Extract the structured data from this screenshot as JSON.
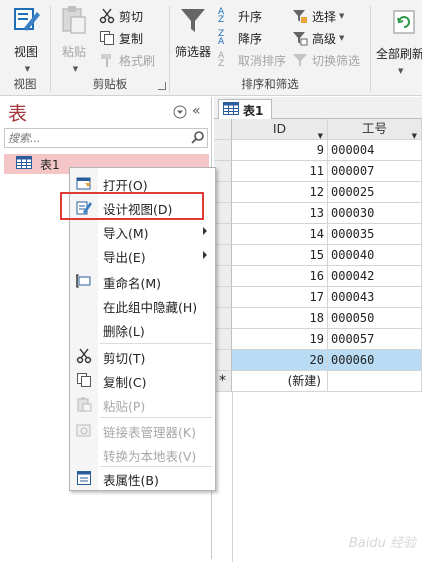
{
  "ribbon": {
    "groups": {
      "view": {
        "label": "视图",
        "view_button": "视图"
      },
      "clipboard": {
        "label": "剪贴板",
        "paste": "粘贴",
        "cut": "剪切",
        "copy": "复制",
        "format_painter": "格式刷"
      },
      "sort_filter": {
        "label": "排序和筛选",
        "filter": "筛选器",
        "asc": "升序",
        "desc": "降序",
        "clear_sort": "取消排序",
        "selection": "选择",
        "advanced": "高级",
        "toggle_filter": "切换筛选"
      },
      "records": {
        "refresh_all": "全部刷新"
      }
    }
  },
  "nav": {
    "title": "表",
    "search_placeholder": "搜索...",
    "items": [
      {
        "label": "表1"
      }
    ]
  },
  "doc": {
    "tab_label": "表1",
    "columns": [
      "ID",
      "工号"
    ],
    "rows": [
      {
        "id": "9",
        "code": "000004"
      },
      {
        "id": "11",
        "code": "000007"
      },
      {
        "id": "12",
        "code": "000025"
      },
      {
        "id": "13",
        "code": "000030"
      },
      {
        "id": "14",
        "code": "000035"
      },
      {
        "id": "15",
        "code": "000040"
      },
      {
        "id": "16",
        "code": "000042"
      },
      {
        "id": "17",
        "code": "000043"
      },
      {
        "id": "18",
        "code": "000050"
      },
      {
        "id": "19",
        "code": "000057"
      },
      {
        "id": "20",
        "code": "000060"
      }
    ],
    "new_row_marker": "*",
    "new_row_label": "(新建)"
  },
  "context_menu": {
    "items": [
      {
        "label": "打开(O)",
        "icon": "open-icon"
      },
      {
        "label": "设计视图(D)",
        "icon": "design-view-icon"
      },
      {
        "label": "导入(M)",
        "icon": ""
      },
      {
        "label": "导出(E)",
        "icon": ""
      },
      {
        "label": "重命名(M)",
        "icon": "rename-icon"
      },
      {
        "label": "在此组中隐藏(H)",
        "icon": ""
      },
      {
        "label": "删除(L)",
        "icon": ""
      },
      {
        "label": "剪切(T)",
        "icon": "cut-icon"
      },
      {
        "label": "复制(C)",
        "icon": "copy-icon"
      },
      {
        "label": "粘贴(P)",
        "icon": "paste-icon"
      },
      {
        "label": "链接表管理器(K)",
        "icon": "linked-table-icon"
      },
      {
        "label": "转换为本地表(V)",
        "icon": ""
      },
      {
        "label": "表属性(B)",
        "icon": "table-properties-icon"
      }
    ]
  },
  "colors": {
    "accent": "#a4373a",
    "highlight": "#e03a33",
    "selected_row": "#b9dcf4",
    "nav_selected": "#f5c6c7"
  }
}
